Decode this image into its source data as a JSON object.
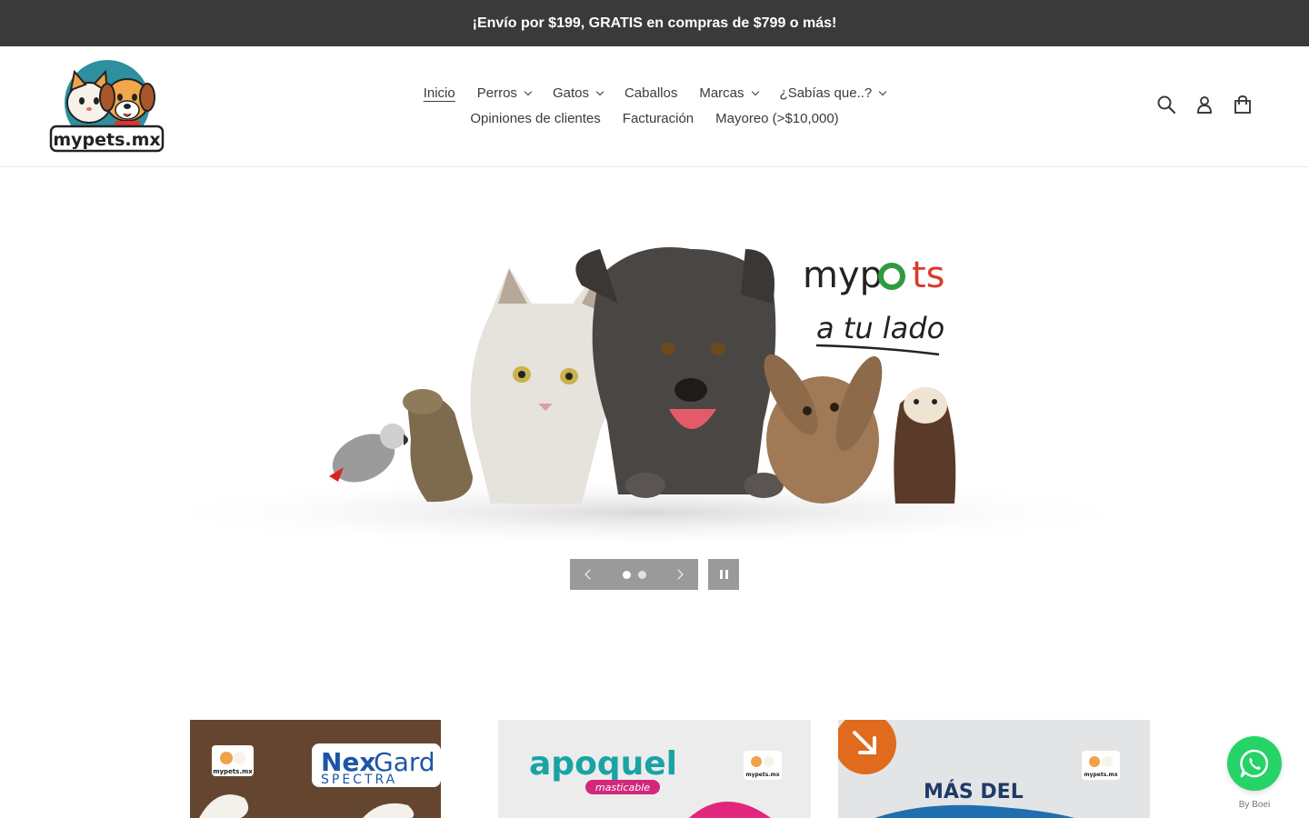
{
  "announcement": "¡Envío por $199, GRATIS en compras de $799 o más!",
  "logo": {
    "text": "mypets.mx"
  },
  "nav": {
    "row1": [
      {
        "label": "Inicio",
        "active": true,
        "dropdown": false
      },
      {
        "label": "Perros",
        "dropdown": true
      },
      {
        "label": "Gatos",
        "dropdown": true
      },
      {
        "label": "Caballos",
        "dropdown": false
      },
      {
        "label": "Marcas",
        "dropdown": true
      },
      {
        "label": "¿Sabías que..?",
        "dropdown": true
      }
    ],
    "row2": [
      {
        "label": "Opiniones de clientes",
        "dropdown": false
      },
      {
        "label": "Facturación",
        "dropdown": false
      },
      {
        "label": "Mayoreo (>$10,000)",
        "dropdown": false
      }
    ]
  },
  "header_icons": [
    "search-icon",
    "account-icon",
    "cart-icon"
  ],
  "hero": {
    "brand": "myp",
    "brand_tail": "ts",
    "tagline": "a tu lado",
    "slides_total": 2,
    "active_slide": 1
  },
  "tiles": [
    {
      "brand": "Nex",
      "brand2": "Gard",
      "sub": "SPECTRA",
      "logo": "mypets.mx"
    },
    {
      "brand": "apoquel",
      "sub": "masticable",
      "logo": "mypets.mx"
    },
    {
      "headline": "MÁS DEL",
      "logo": "mypets.mx"
    }
  ],
  "whatsapp": {
    "credit": "By Boei"
  },
  "colors": {
    "announce_bg": "#3a3a3a",
    "whatsapp": "#25d366",
    "slider_ctrl": "#9a9a9a"
  }
}
